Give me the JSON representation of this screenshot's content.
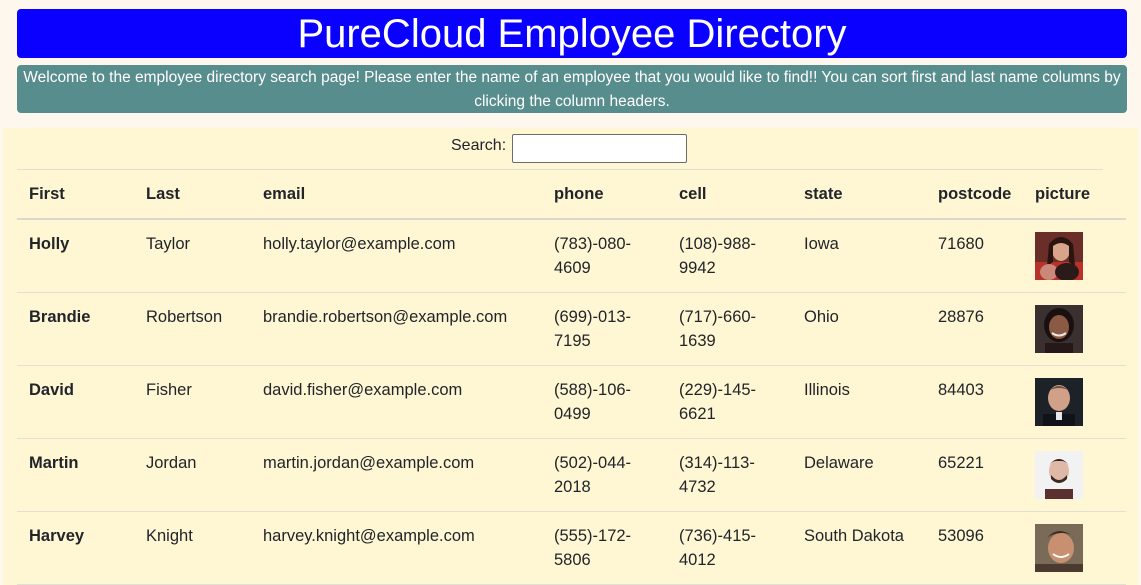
{
  "header": {
    "title": "PureCloud Employee Directory"
  },
  "welcome": {
    "text": "Welcome to the employee directory search page! Please enter the name of an employee that you would like to find!! You can sort first and last name columns by clicking the column headers."
  },
  "search": {
    "label": "Search:",
    "value": "",
    "placeholder": ""
  },
  "table": {
    "columns": [
      "First",
      "Last",
      "email",
      "phone",
      "cell",
      "state",
      "postcode",
      "picture"
    ],
    "rows": [
      {
        "first": "Holly",
        "last": "Taylor",
        "email": "holly.taylor@example.com",
        "phone": "(783)-080-4609",
        "cell": "(108)-988-9942",
        "state": "Iowa",
        "postcode": "71680"
      },
      {
        "first": "Brandie",
        "last": "Robertson",
        "email": "brandie.robertson@example.com",
        "phone": "(699)-013-7195",
        "cell": "(717)-660-1639",
        "state": "Ohio",
        "postcode": "28876"
      },
      {
        "first": "David",
        "last": "Fisher",
        "email": "david.fisher@example.com",
        "phone": "(588)-106-0499",
        "cell": "(229)-145-6621",
        "state": "Illinois",
        "postcode": "84403"
      },
      {
        "first": "Martin",
        "last": "Jordan",
        "email": "martin.jordan@example.com",
        "phone": "(502)-044-2018",
        "cell": "(314)-113-4732",
        "state": "Delaware",
        "postcode": "65221"
      },
      {
        "first": "Harvey",
        "last": "Knight",
        "email": "harvey.knight@example.com",
        "phone": "(555)-172-5806",
        "cell": "(736)-415-4012",
        "state": "South Dakota",
        "postcode": "53096"
      }
    ]
  },
  "colors": {
    "header_bg": "#0a00ff",
    "welcome_bg": "#578d8c",
    "table_bg": "#fff6d4",
    "page_bg": "#fdf7ee"
  }
}
